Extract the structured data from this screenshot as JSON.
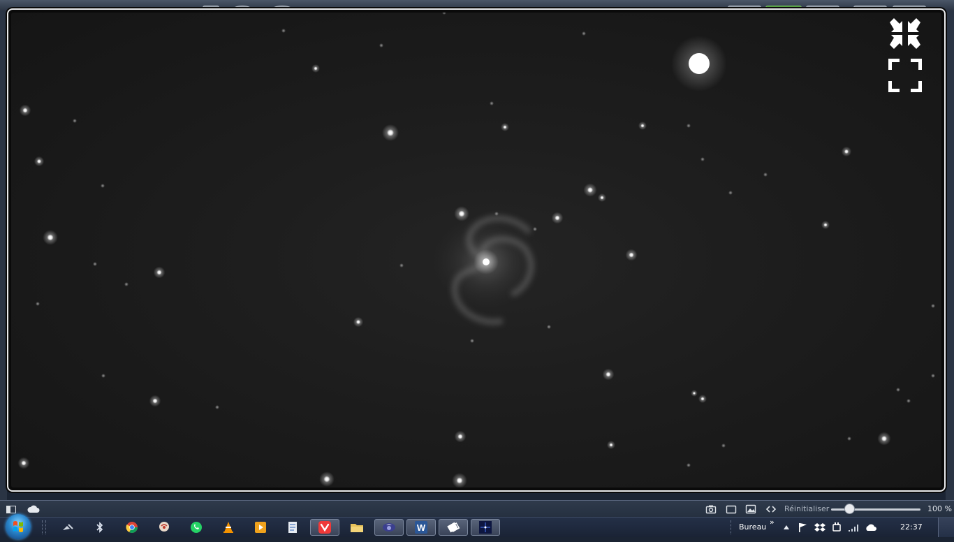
{
  "viewer": {
    "controls": {
      "shrink": "exit-fullscreen-icon",
      "expand": "fullscreen-icon"
    },
    "toolbar": {
      "icons": [
        "screenshot-icon",
        "window-icon",
        "image-icon",
        "code-icon"
      ],
      "reset_label": "Réinitialiser",
      "zoom_level": "100 %",
      "zoom_fraction": 0.2
    }
  },
  "taskbar": {
    "apps": [
      {
        "name": "satellite-icon",
        "active": false
      },
      {
        "name": "bluetooth-icon",
        "active": false
      },
      {
        "name": "chrome-icon",
        "active": false
      },
      {
        "name": "brain-icon",
        "active": false
      },
      {
        "name": "whatsapp-icon",
        "active": false
      },
      {
        "name": "vlc-icon",
        "active": false
      },
      {
        "name": "media-player-icon",
        "active": false
      },
      {
        "name": "notes-icon",
        "active": false
      },
      {
        "name": "vivaldi-icon",
        "active": true
      },
      {
        "name": "folder-icon",
        "active": false
      },
      {
        "name": "moon-icon",
        "active": true
      },
      {
        "name": "word-icon",
        "active": true
      },
      {
        "name": "photos-icon",
        "active": true
      },
      {
        "name": "astro-app-icon",
        "active": true
      }
    ],
    "desktop_label": "Bureau",
    "clock": "22:37"
  },
  "colors": {
    "sky": "#1b1b1b",
    "frame": "#e9eaec",
    "taskbar": "#1f2a3d",
    "vivaldi": "#ef3939",
    "word": "#2b5797"
  }
}
